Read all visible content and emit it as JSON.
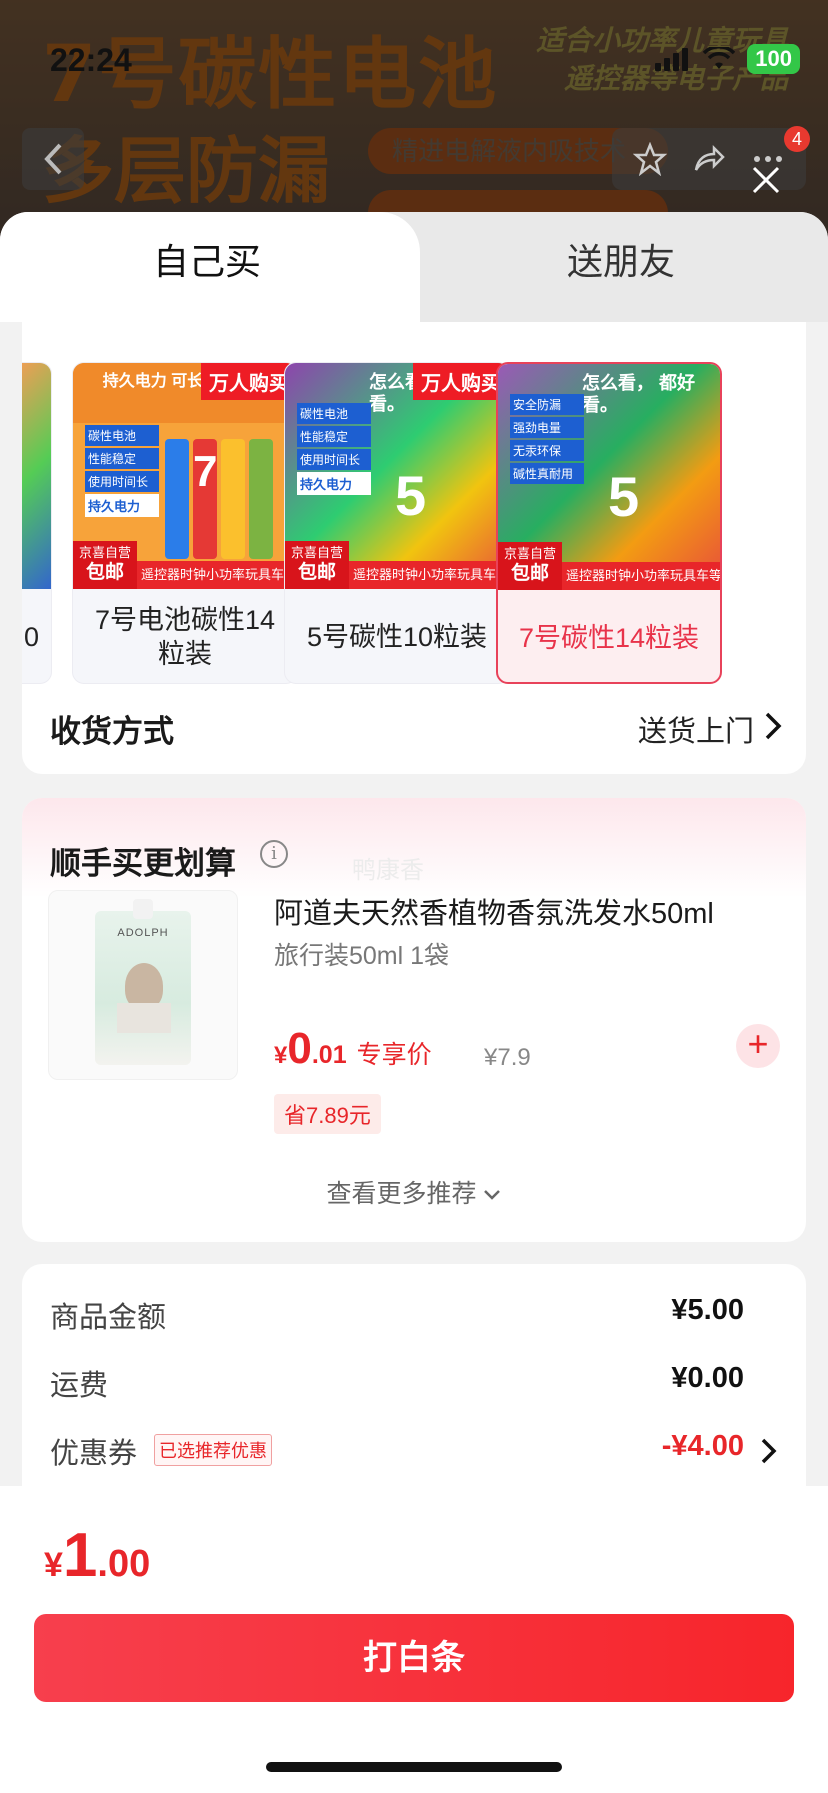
{
  "background": {
    "headline1": "7号碳性电池",
    "headline2": "多层防漏",
    "right_line1": "适合小功率儿童玩具",
    "right_line2": "遥控器等电子产品",
    "pill": "精进电解液内吸技术"
  },
  "status_bar": {
    "time": "22:24",
    "battery": "100"
  },
  "top_nav": {
    "badge_count": "4"
  },
  "tabs": [
    {
      "label": "自己买"
    },
    {
      "label": "送朋友"
    }
  ],
  "products": [
    {
      "name": "0",
      "partial": true
    },
    {
      "name": "7号电池碳性14粒装",
      "tag": "万人购买",
      "img_title": "持久电力 可长时间囤放",
      "img_features": [
        "碳性电池",
        "性能稳定",
        "使用时间长",
        "持久电力"
      ],
      "img_digit": "7",
      "jd_line1": "京喜自营",
      "jd_line2": "包邮",
      "strip": "遥控器时钟小功率玩具车等"
    },
    {
      "name": "5号碳性10粒装",
      "tag": "万人购买",
      "img_title": "怎么看， 都好看。",
      "img_features": [
        "碳性电池",
        "性能稳定",
        "使用时间长",
        "持久电力"
      ],
      "img_digit": "5",
      "jd_line1": "京喜自营",
      "jd_line2": "包邮",
      "strip": "遥控器时钟小功率玩具车等"
    },
    {
      "name": "7号碳性14粒装",
      "selected": true,
      "img_title": "怎么看， 都好看。",
      "img_features": [
        "安全防漏",
        "强劲电量",
        "无汞环保",
        "碱性真耐用"
      ],
      "img_digit": "5",
      "jd_line1": "京喜自营",
      "jd_line2": "包邮",
      "strip": "遥控器时钟小功率玩具车等"
    }
  ],
  "delivery": {
    "label": "收货方式",
    "value": "送货上门"
  },
  "upsell": {
    "title": "顺手买更划算",
    "watermark": "鸭康香",
    "item": {
      "name": "阿道夫天然香植物香氛洗发水50ml",
      "spec": "旅行装50ml 1袋",
      "currency": "¥",
      "price_int": "0",
      "price_dec": ".01",
      "price_label": "专享价",
      "original_price": "¥7.9",
      "save": "省7.89元",
      "brand": "ADOLPH"
    },
    "more": "查看更多推荐"
  },
  "summary": {
    "goods_label": "商品金额",
    "goods_value": "¥5.00",
    "shipping_label": "运费",
    "shipping_value": "¥0.00",
    "coupon_label": "优惠券",
    "coupon_tag": "已选推荐优惠",
    "coupon_value": "-¥4.00"
  },
  "footer": {
    "currency": "¥",
    "total_int": "1",
    "total_dec": ".00",
    "pay_label": "打白条"
  },
  "colors": {
    "accent": "#e8262a",
    "selected_border": "#e8425a",
    "pay_button": "#f7252b"
  }
}
